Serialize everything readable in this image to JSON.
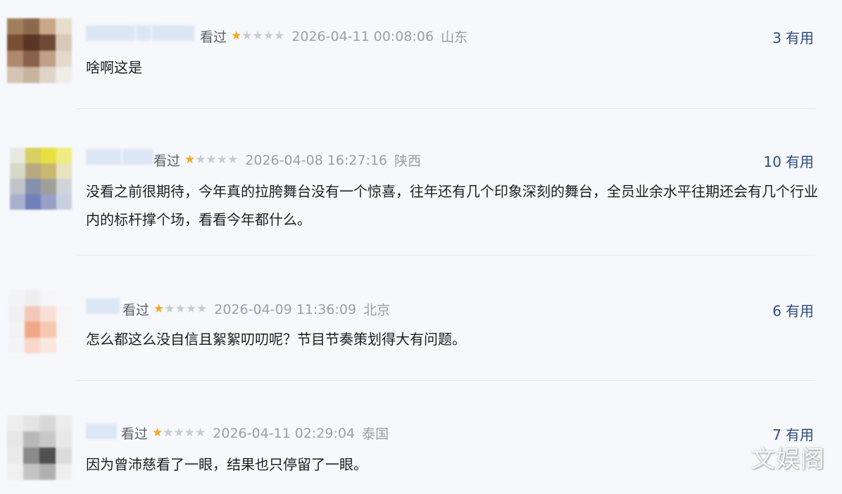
{
  "comments": [
    {
      "seen_label": "看过",
      "rating": 1,
      "max_rating": 5,
      "timestamp": "2026-04-11 00:08:06",
      "location": "山东",
      "useful_count": "3",
      "useful_label": "有用",
      "text": "啥啊这是"
    },
    {
      "seen_label": "看过",
      "rating": 1,
      "max_rating": 5,
      "timestamp": "2026-04-08 16:27:16",
      "location": "陕西",
      "useful_count": "10",
      "useful_label": "有用",
      "text": "没看之前很期待，今年真的拉胯舞台没有一个惊喜，往年还有几个印象深刻的舞台，全员业余水平往期还会有几个行业内的标杆撑个场，看看今年都什么。"
    },
    {
      "seen_label": "看过",
      "rating": 1,
      "max_rating": 5,
      "timestamp": "2026-04-09 11:36:09",
      "location": "北京",
      "useful_count": "6",
      "useful_label": "有用",
      "text": "怎么都这么没自信且絮絮叨叨呢？节目节奏策划得大有问题。"
    },
    {
      "seen_label": "看过",
      "rating": 1,
      "max_rating": 5,
      "timestamp": "2026-04-11 02:29:04",
      "location": "泰国",
      "useful_count": "7",
      "useful_label": "有用",
      "text": "因为曾沛慈看了一眼，结果也只停留了一眼。"
    }
  ],
  "watermark": "文娱阁",
  "colors": {
    "star_on": "#f5a623",
    "star_off": "#c8ccd2",
    "useful": "#2f4d80",
    "meta": "#9aa0a8",
    "background": "#f6f8fc"
  },
  "avatars": [
    {
      "icon": "blurred-avatar",
      "pixels": [
        "#a0805c",
        "#8a6a4a",
        "#c8a887",
        "#e8dccb",
        "#7a4e34",
        "#5a3424",
        "#6e4a36",
        "#d8c8b8",
        "#b08870",
        "#8a604a",
        "#c0a088",
        "#e4d8cc",
        "#d4c4b4",
        "#c8b4a0",
        "#e0d4c8",
        "#f0ece8"
      ]
    },
    {
      "icon": "blurred-avatar",
      "pixels": [
        "#e8e8e0",
        "#d8d060",
        "#e8e040",
        "#f0ec80",
        "#d8d8c8",
        "#b8a880",
        "#c8b870",
        "#e8e4c0",
        "#c0c4c8",
        "#8890b0",
        "#a0a098",
        "#d0d4d8",
        "#a8b0d0",
        "#7080b8",
        "#98a0c8",
        "#c8d0e0"
      ]
    },
    {
      "icon": "blurred-avatar",
      "pixels": [
        "#f4f4f6",
        "#eeeef2",
        "#f6f6f8",
        "#f8f8fa",
        "#f0f0f2",
        "#f4c8b8",
        "#f8e0d8",
        "#f6f6f8",
        "#f2f2f4",
        "#f0a888",
        "#f6c8b0",
        "#f6f6f8",
        "#f4f4f6",
        "#f8d8c8",
        "#f8e8e0",
        "#f8f8fa"
      ]
    },
    {
      "icon": "blurred-avatar",
      "pixels": [
        "#eeeeee",
        "#e4e4e4",
        "#d8d8d8",
        "#ececec",
        "#e6e6e6",
        "#b8b8b8",
        "#c8c8c8",
        "#e8e8e8",
        "#eaeaea",
        "#8a8a8a",
        "#505050",
        "#dcdcdc",
        "#f0f0f0",
        "#c4c4c4",
        "#b0b0b0",
        "#eeeeee"
      ]
    }
  ]
}
